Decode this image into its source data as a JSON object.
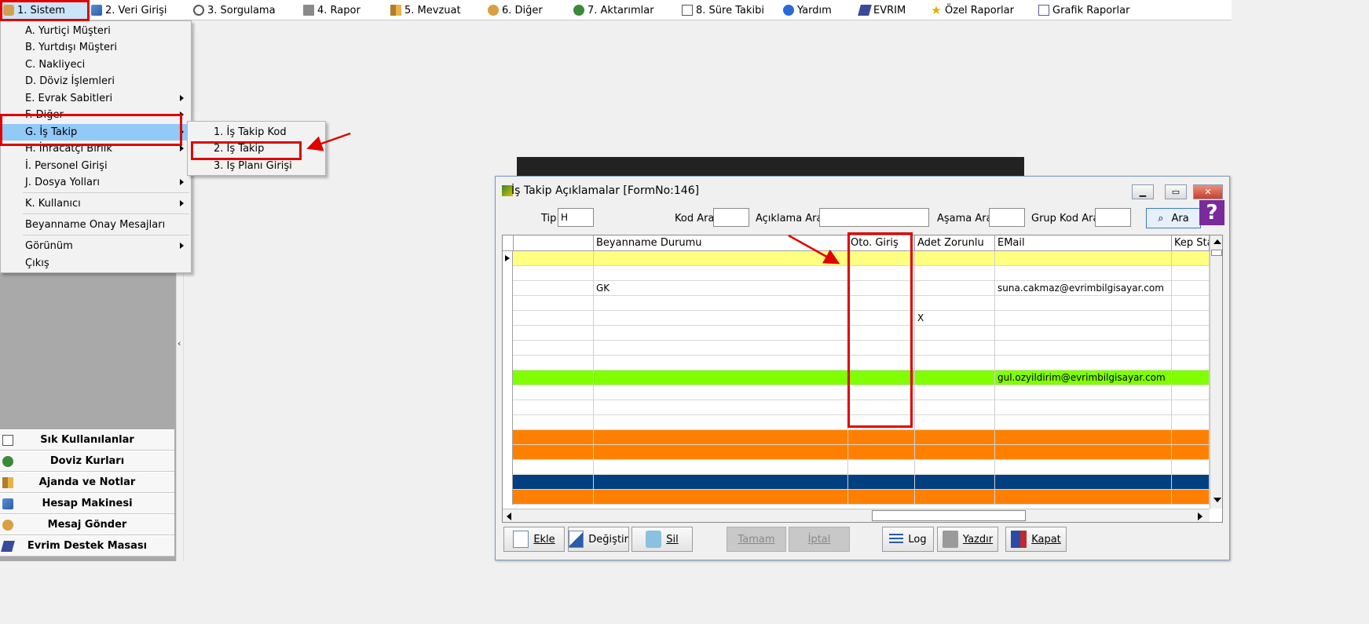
{
  "menubar": {
    "items": [
      {
        "label": "1.  Sistem",
        "icon": "system-icon"
      },
      {
        "label": "2.  Veri Girişi",
        "icon": "data-entry-icon"
      },
      {
        "label": "3.  Sorgulama",
        "icon": "query-icon"
      },
      {
        "label": "4.  Rapor",
        "icon": "printer-icon"
      },
      {
        "label": "5.  Mevzuat",
        "icon": "books-icon"
      },
      {
        "label": "6.  Diğer",
        "icon": "other-icon"
      },
      {
        "label": "7.  Aktarımlar",
        "icon": "transfer-icon"
      },
      {
        "label": "8. Süre Takibi",
        "icon": "calendar-icon"
      },
      {
        "label": "Yardım",
        "icon": "help-icon"
      },
      {
        "label": "EVRIM",
        "icon": "evrim-icon"
      },
      {
        "label": "Özel Raporlar",
        "icon": "star-icon"
      },
      {
        "label": "Grafik Raporlar",
        "icon": "chart-icon"
      }
    ]
  },
  "sistem_menu": {
    "items": [
      {
        "label": "A.  Yurtiçi Müşteri"
      },
      {
        "label": "B.  Yurtdışı Müşteri"
      },
      {
        "label": "C.  Nakliyeci"
      },
      {
        "label": "D.  Döviz İşlemleri"
      },
      {
        "label": "E.  Evrak Sabitleri"
      },
      {
        "label": "F.  Diğer"
      },
      {
        "label": "G.  İş Takip"
      },
      {
        "label": "H.  İhracatçı Birlik"
      },
      {
        "label": "İ.   Personel Girişi"
      },
      {
        "label": "J.  Dosya Yolları"
      },
      {
        "label": "K.  Kullanıcı"
      },
      {
        "label": "Beyanname Onay Mesajları"
      },
      {
        "label": "Görünüm"
      },
      {
        "label": "Çıkış"
      }
    ]
  },
  "is_takip_submenu": {
    "items": [
      {
        "label": "1.  İş Takip Kod"
      },
      {
        "label": "2.  İş Takip"
      },
      {
        "label": "3.  İş Planı Girişi"
      }
    ]
  },
  "left_panel": {
    "buttons": [
      {
        "label": "Sık Kullanılanlar",
        "icon": "favorites-icon"
      },
      {
        "label": "Doviz Kurları",
        "icon": "currency-icon"
      },
      {
        "label": "Ajanda ve Notlar",
        "icon": "notes-icon"
      },
      {
        "label": "Hesap Makinesi",
        "icon": "calculator-icon"
      },
      {
        "label": "Mesaj Gönder",
        "icon": "message-icon"
      },
      {
        "label": "Evrim Destek Masası",
        "icon": "support-icon"
      }
    ],
    "collapse_glyph": "‹"
  },
  "window": {
    "title": "İş Takip Açıklamalar [FormNo:146]",
    "filters": {
      "tip_label": "Tip",
      "tip_value": "H",
      "kod_ara_label": "Kod Ara",
      "aciklama_ara_label": "Açıklama  Ara",
      "asama_ara_label": "Aşama Ara",
      "grup_kod_ara_label": "Grup Kod Ara",
      "ara_button": "Ara"
    },
    "grid": {
      "columns": [
        "",
        "Beyanname Durumu",
        "Oto. Giriş",
        "Adet Zorunlu",
        "EMail",
        "Kep Sta"
      ],
      "rows": [
        {
          "cells": [
            "",
            "",
            "",
            "",
            "",
            ""
          ],
          "color": "#ffff80",
          "current": true
        },
        {
          "cells": [
            "",
            "",
            "",
            "",
            "",
            ""
          ],
          "color": "#ffffff"
        },
        {
          "cells": [
            "",
            "GK",
            "",
            "",
            "suna.cakmaz@evrimbilgisayar.com",
            ""
          ],
          "color": "#ffffff"
        },
        {
          "cells": [
            "",
            "",
            "",
            "",
            "",
            ""
          ],
          "color": "#ffffff"
        },
        {
          "cells": [
            "",
            "",
            "",
            "X",
            "",
            ""
          ],
          "color": "#ffffff"
        },
        {
          "cells": [
            "",
            "",
            "",
            "",
            "",
            ""
          ],
          "color": "#ffffff"
        },
        {
          "cells": [
            "",
            "",
            "",
            "",
            "",
            ""
          ],
          "color": "#ffffff"
        },
        {
          "cells": [
            "",
            "",
            "",
            "",
            "",
            ""
          ],
          "color": "#ffffff"
        },
        {
          "cells": [
            "",
            "",
            "",
            "",
            "gul.ozyildirim@evrimbilgisayar.com",
            ""
          ],
          "color": "#80ff00"
        },
        {
          "cells": [
            "",
            "",
            "",
            "",
            "",
            ""
          ],
          "color": "#ffffff"
        },
        {
          "cells": [
            "",
            "",
            "",
            "",
            "",
            ""
          ],
          "color": "#ffffff"
        },
        {
          "cells": [
            "",
            "",
            "",
            "",
            "",
            ""
          ],
          "color": "#ffffff"
        },
        {
          "cells": [
            "",
            "",
            "",
            "",
            "",
            ""
          ],
          "color": "#ff8000"
        },
        {
          "cells": [
            "",
            "",
            "",
            "",
            "",
            ""
          ],
          "color": "#ff8000"
        },
        {
          "cells": [
            "",
            "",
            "",
            "",
            "",
            ""
          ],
          "color": "#ffffff"
        },
        {
          "cells": [
            "",
            "",
            "",
            "",
            "",
            ""
          ],
          "color": "#004080"
        },
        {
          "cells": [
            "",
            "",
            "",
            "",
            "",
            ""
          ],
          "color": "#ff8000"
        }
      ]
    },
    "buttons": {
      "ekle": "Ekle",
      "degistir": "Değiştir",
      "sil": "Sil",
      "tamam": "Tamam",
      "iptal": "İptal",
      "log": "Log",
      "yazdir": "Yazdır",
      "kapat": "Kapat"
    },
    "help_glyph": "?"
  },
  "colors": {
    "highlight": "#91c9f7",
    "annotation_red": "#e00000",
    "row_yellow": "#ffff80",
    "row_green": "#80ff00",
    "row_orange": "#ff8000",
    "row_navy": "#004080"
  }
}
